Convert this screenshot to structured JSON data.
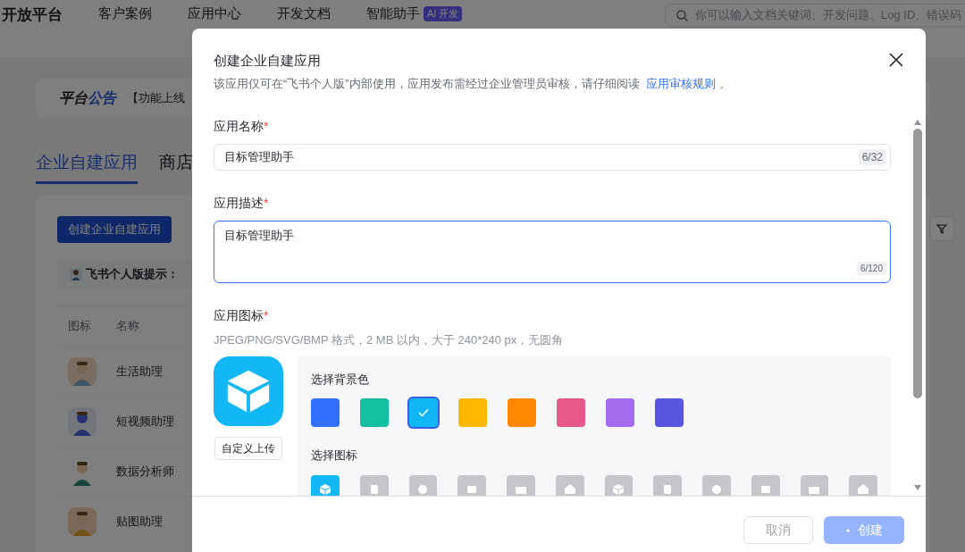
{
  "header": {
    "brand": "开放平台",
    "nav": [
      "客户案例",
      "应用中心",
      "开发文档",
      "智能助手"
    ],
    "nav_badge": "AI 开发",
    "search": {
      "placeholder": "你可以输入文档关键词、开发问题、Log ID、错误码"
    }
  },
  "notice": {
    "title_main": "平台",
    "title_accent": "公告",
    "text": "【功能上线"
  },
  "tabs": [
    {
      "label": "企业自建应用",
      "selected": true
    },
    {
      "label": "商店",
      "selected": false
    }
  ],
  "create_button": "创建企业自建应用",
  "tip": {
    "label": "飞书个人版提示："
  },
  "table": {
    "columns": [
      "图标",
      "名称"
    ],
    "rows": [
      {
        "name": "生活助理"
      },
      {
        "name": "短视频助理"
      },
      {
        "name": "数据分析师"
      },
      {
        "name": "贴图助理"
      }
    ]
  },
  "dialog": {
    "title": "创建企业自建应用",
    "description": "该应用仅可在“飞书个人版”内部使用，应用发布需经过企业管理员审核，请仔细阅读",
    "link": "应用审核规则",
    "description_end": "。",
    "fields": [
      {
        "kind": "input",
        "label": "应用名称",
        "required_mark": "*",
        "value": "目标管理助手",
        "counter": "6/32",
        "focused": false
      },
      {
        "kind": "textarea",
        "label": "应用描述",
        "required_mark": "*",
        "value": "目标管理助手",
        "counter": "6/120",
        "focused": true
      }
    ],
    "icon_section": {
      "label": "应用图标",
      "required_mark": "*",
      "hint": "JPEG/PNG/SVG/BMP 格式，2 MB 以内，大于 240*240 px，无圆角",
      "upload_button": "自定义上传",
      "color_label": "选择背景色",
      "colors": [
        {
          "color": "#3370ff",
          "selected": false
        },
        {
          "color": "#14c0a0",
          "selected": false
        },
        {
          "color": "#12b8f5",
          "selected": true
        },
        {
          "color": "#ffb800",
          "selected": false
        },
        {
          "color": "#ff8800",
          "selected": false
        },
        {
          "color": "#e8588a",
          "selected": false
        },
        {
          "color": "#a66cf0",
          "selected": false
        },
        {
          "color": "#5856e0",
          "selected": false
        }
      ],
      "icon_label": "选择图标",
      "icons": [
        {
          "selected": true
        },
        {
          "selected": false
        },
        {
          "selected": false
        },
        {
          "selected": false
        },
        {
          "selected": false
        },
        {
          "selected": false
        },
        {
          "selected": false
        },
        {
          "selected": false
        },
        {
          "selected": false
        },
        {
          "selected": false
        },
        {
          "selected": false
        },
        {
          "selected": false
        }
      ]
    },
    "buttons": [
      {
        "kind": "cancel",
        "label": "取消",
        "disabled": true,
        "loading": false
      },
      {
        "kind": "primary",
        "label": "创建",
        "disabled": true,
        "loading": true
      }
    ]
  }
}
